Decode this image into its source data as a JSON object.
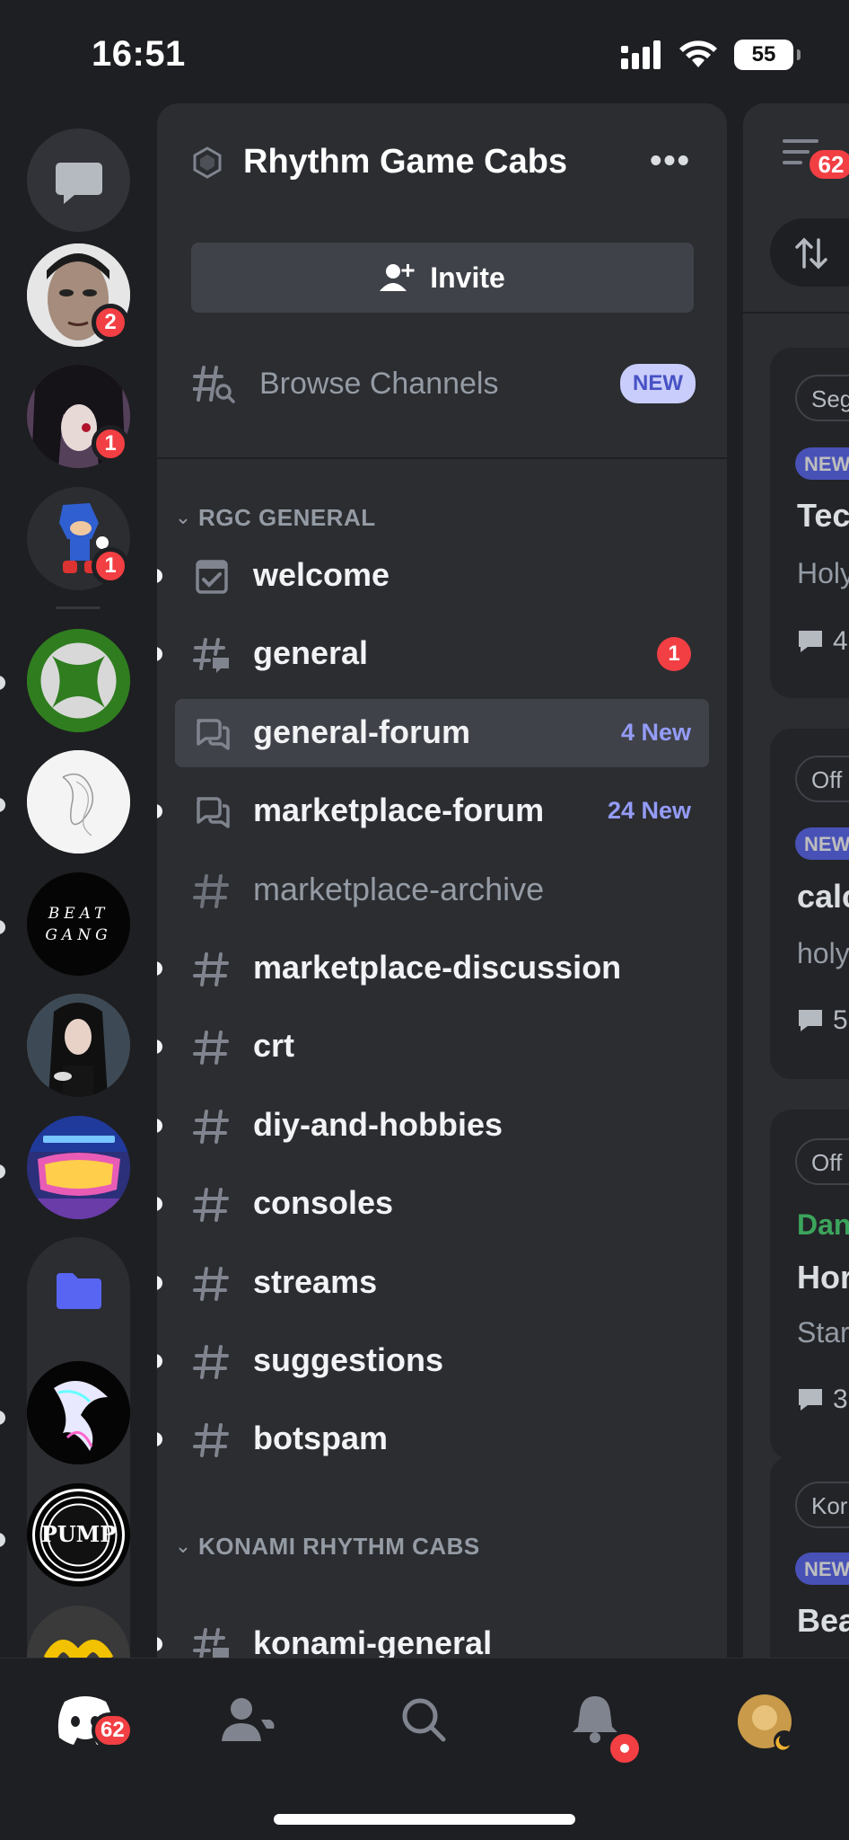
{
  "status_bar": {
    "time": "16:51",
    "battery": "55"
  },
  "rail": {
    "badges": [
      "2",
      "1",
      "1"
    ],
    "servers": [
      {
        "name": "server-avatar-man",
        "color": "#2a2a2a"
      },
      {
        "name": "server-avatar-anime",
        "color": "#3a2c3a"
      },
      {
        "name": "server-avatar-sonic",
        "color": "#25262a"
      },
      {
        "name": "server-avatar-xbox",
        "color": "#3a8a2a"
      },
      {
        "name": "server-avatar-sketch",
        "color": "#f1f1f1"
      },
      {
        "name": "server-avatar-beat-gang",
        "color": "#050505"
      },
      {
        "name": "server-avatar-portrait",
        "color": "#4a3a3a"
      },
      {
        "name": "server-avatar-pump-it-up",
        "color": "#352a6a"
      }
    ],
    "beat_gang_text": "BEAT GANG",
    "pump_logo_text": "PUMP"
  },
  "server": {
    "name": "Rhythm Game Cabs",
    "invite_label": "Invite",
    "browse_label": "Browse Channels",
    "browse_badge": "NEW"
  },
  "categories": [
    {
      "label": "RGC GENERAL"
    },
    {
      "label": "KONAMI RHYTHM CABS"
    }
  ],
  "channels": [
    {
      "name": "welcome",
      "icon": "rules-icon",
      "unread": true,
      "muted": false
    },
    {
      "name": "general",
      "icon": "hash-thread-icon",
      "unread": true,
      "muted": false,
      "badge": "1"
    },
    {
      "name": "general-forum",
      "icon": "forum-icon",
      "unread": false,
      "muted": false,
      "new": "4 New",
      "active": true
    },
    {
      "name": "marketplace-forum",
      "icon": "forum-icon",
      "unread": true,
      "muted": false,
      "new": "24 New"
    },
    {
      "name": "marketplace-archive",
      "icon": "hash-icon",
      "unread": false,
      "muted": true
    },
    {
      "name": "marketplace-discussion",
      "icon": "hash-icon",
      "unread": true,
      "muted": false
    },
    {
      "name": "crt",
      "icon": "hash-icon",
      "unread": true,
      "muted": false
    },
    {
      "name": "diy-and-hobbies",
      "icon": "hash-icon",
      "unread": true,
      "muted": false
    },
    {
      "name": "consoles",
      "icon": "hash-icon",
      "unread": true,
      "muted": false
    },
    {
      "name": "streams",
      "icon": "hash-icon",
      "unread": true,
      "muted": false
    },
    {
      "name": "suggestions",
      "icon": "hash-icon",
      "unread": true,
      "muted": false
    },
    {
      "name": "botspam",
      "icon": "hash-icon",
      "unread": true,
      "muted": false
    },
    {
      "name": "konami-general",
      "icon": "hash-thread-icon",
      "unread": true,
      "muted": false
    }
  ],
  "peek": {
    "badge": "62",
    "cards": [
      {
        "tag": "Seg",
        "new": "NEW",
        "title": "Tec",
        "text": "Holy",
        "count": "4"
      },
      {
        "tag": "Off",
        "new": "NEW",
        "title": "calc",
        "text": "holy",
        "count": "5"
      },
      {
        "tag": "Off",
        "author": "Dan",
        "title": "Hor",
        "text": "Star",
        "count": "3"
      },
      {
        "tag": "Kor",
        "new": "NEW",
        "title": "Bea"
      }
    ]
  },
  "tabbar": {
    "home_badge": "62"
  },
  "colors": {
    "accent": "#5865f2",
    "danger": "#f23f43",
    "new_text": "#949cf7"
  }
}
